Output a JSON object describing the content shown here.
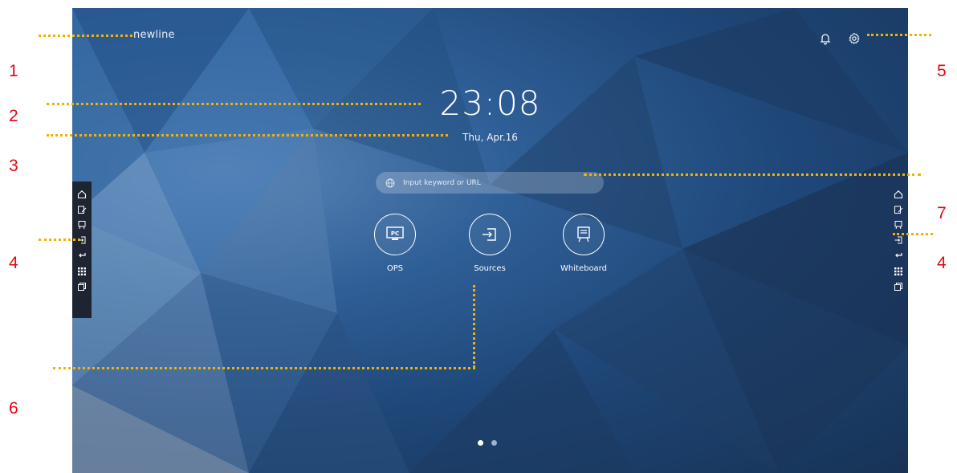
{
  "screen": {
    "brand": "newline",
    "clock": "23:08",
    "date": "Thu, Apr.16",
    "search": {
      "placeholder": "Input keyword or URL",
      "icon": "globe-icon"
    },
    "top_icons": [
      "bell-icon",
      "gear-icon"
    ],
    "apps": [
      {
        "label": "OPS",
        "icon": "pc-icon"
      },
      {
        "label": "Sources",
        "icon": "input-source-icon"
      },
      {
        "label": "Whiteboard",
        "icon": "whiteboard-icon"
      }
    ],
    "page_indicator": {
      "pages": 2,
      "current": 1
    },
    "sidebar_icons": [
      "home-icon",
      "annotate-icon",
      "whiteboard-icon",
      "source-icon",
      "back-icon",
      "apps-icon",
      "windows-icon"
    ]
  },
  "callouts": [
    "1",
    "2",
    "3",
    "4",
    "4",
    "5",
    "6",
    "7"
  ],
  "colors": {
    "callout_line": "#f2b203",
    "callout_number": "#e30613",
    "screen_bg": "#1e4677"
  }
}
